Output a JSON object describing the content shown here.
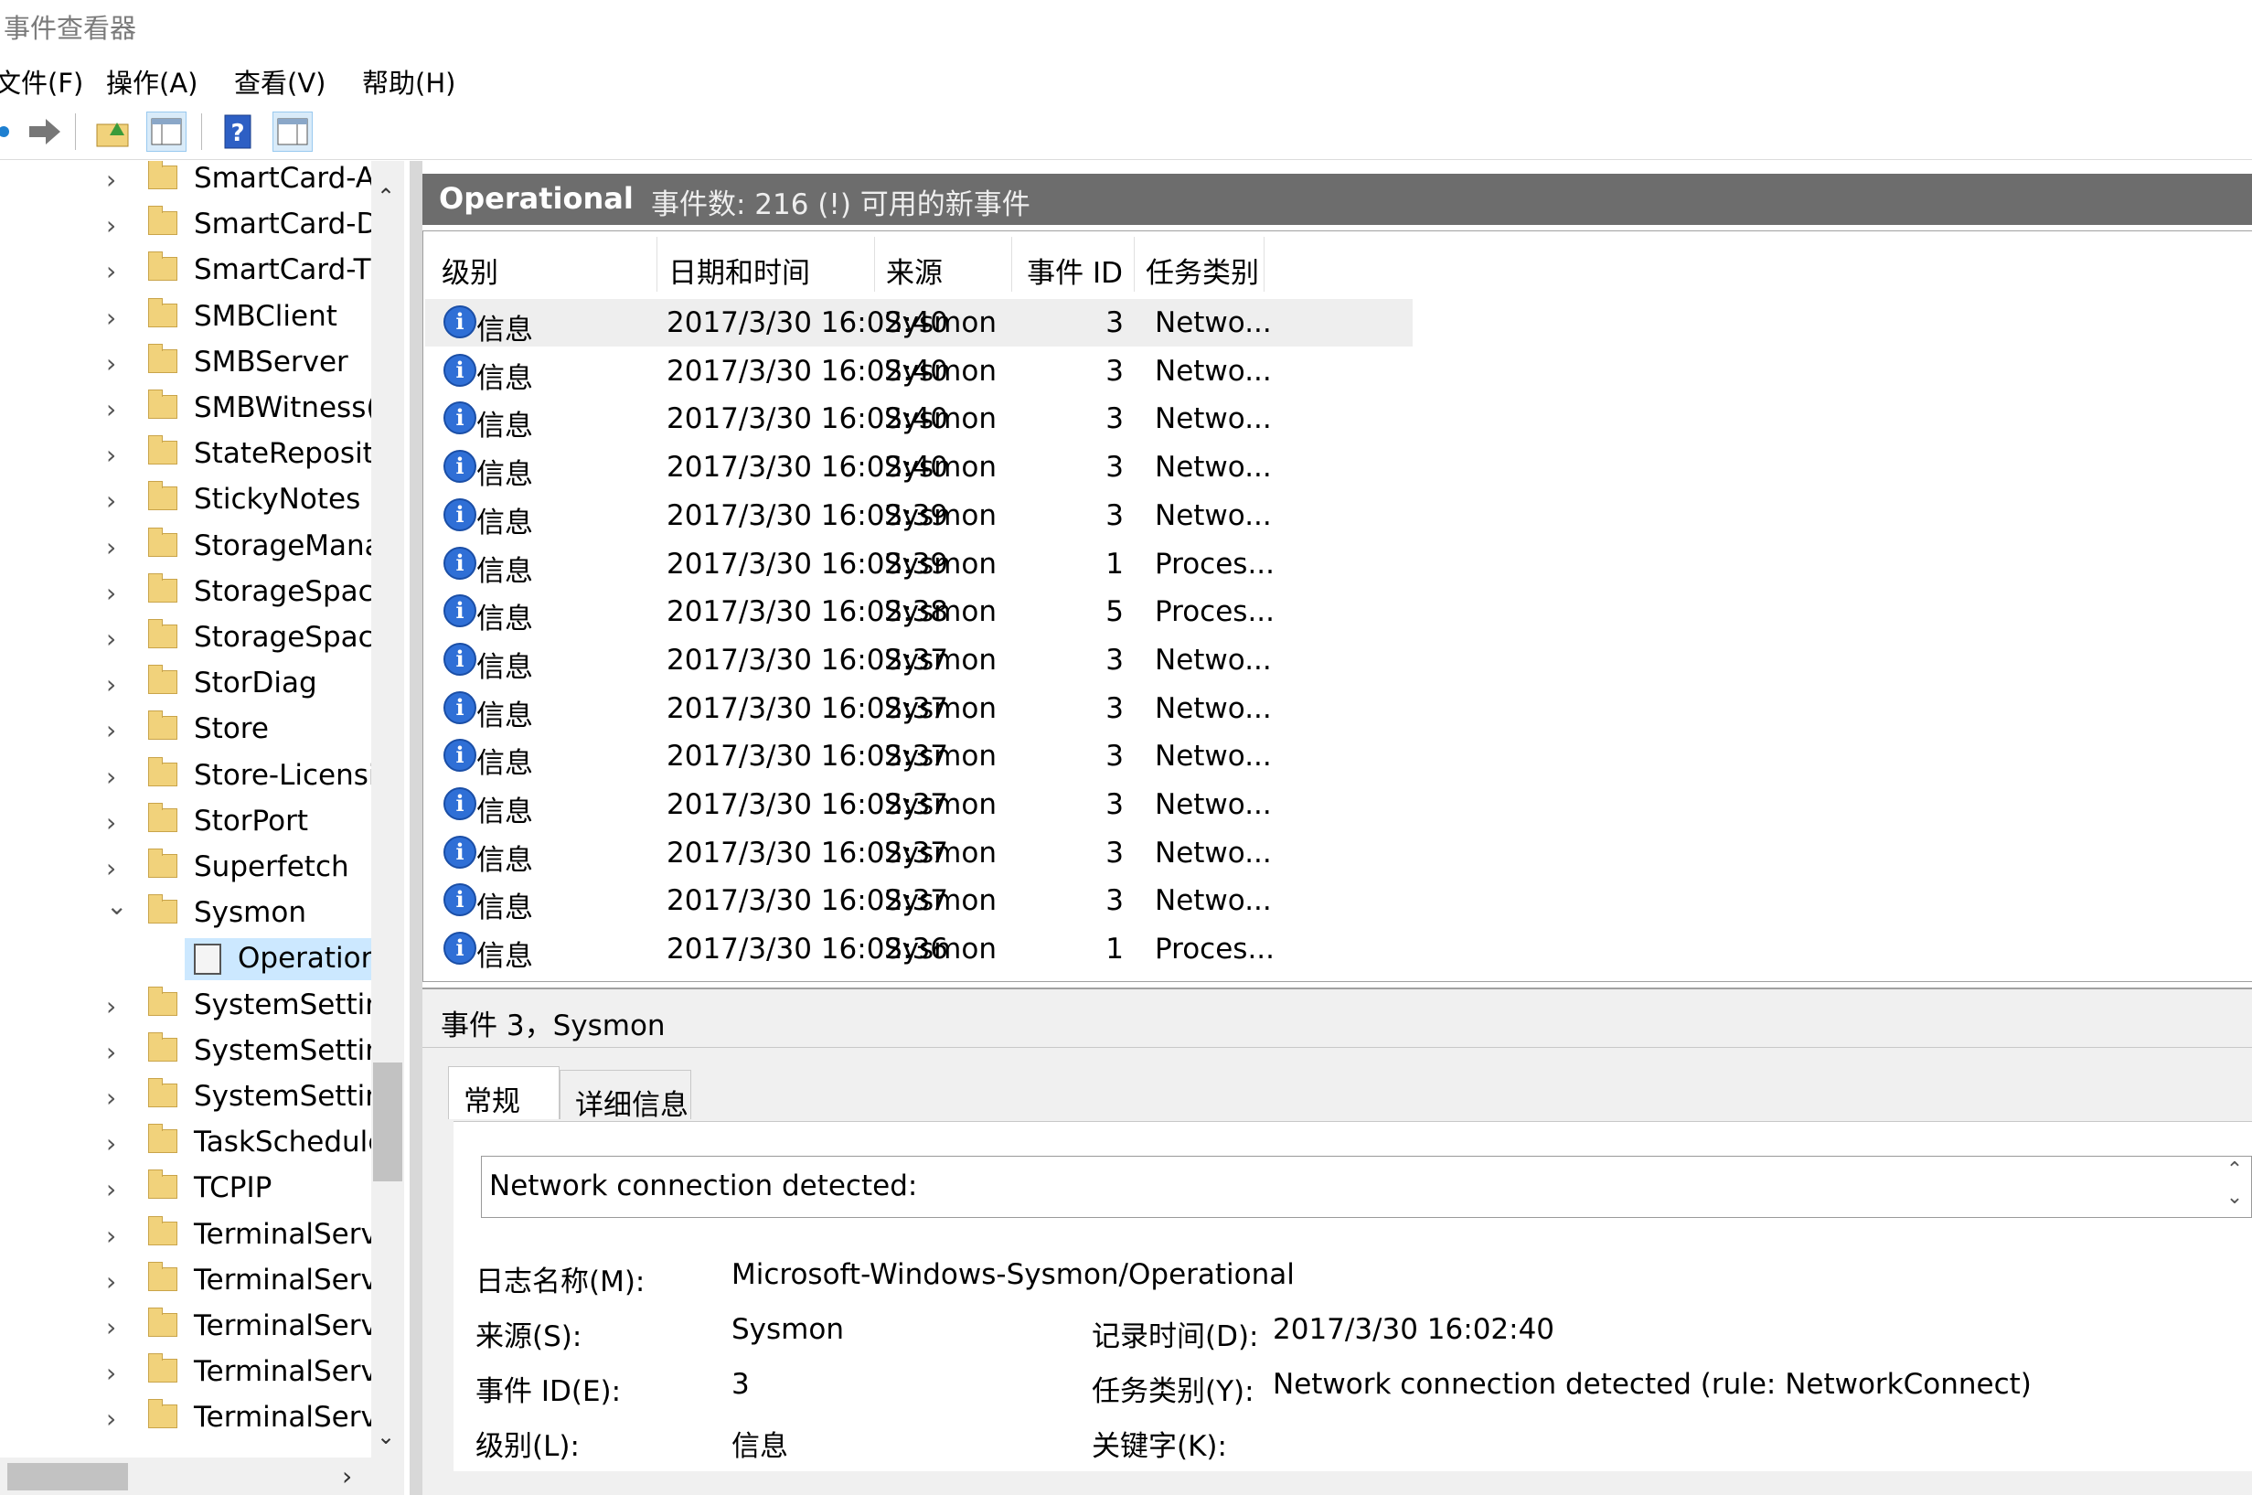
{
  "window": {
    "title": "事件查看器"
  },
  "menu": [
    {
      "label": "文件(F)"
    },
    {
      "label": "操作(A)"
    },
    {
      "label": "查看(V)"
    },
    {
      "label": "帮助(H)"
    }
  ],
  "toolbar": {
    "buttons": [
      {
        "icon": "back-icon"
      },
      {
        "icon": "forward-icon"
      },
      {
        "icon": "up-folder-icon"
      },
      {
        "icon": "show-hide-tree-icon"
      },
      {
        "icon": "help-icon"
      },
      {
        "icon": "show-hide-action-pane-icon"
      }
    ]
  },
  "tree": {
    "items": [
      {
        "label": "SmartCard-A",
        "expanded": false
      },
      {
        "label": "SmartCard-D",
        "expanded": false
      },
      {
        "label": "SmartCard-TI",
        "expanded": false
      },
      {
        "label": "SMBClient",
        "expanded": false
      },
      {
        "label": "SMBServer",
        "expanded": false
      },
      {
        "label": "SMBWitness(",
        "expanded": false
      },
      {
        "label": "StateReposito",
        "expanded": false
      },
      {
        "label": "StickyNotes",
        "expanded": false
      },
      {
        "label": "StorageMana",
        "expanded": false
      },
      {
        "label": "StorageSpac",
        "expanded": false
      },
      {
        "label": "StorageSpac",
        "expanded": false
      },
      {
        "label": "StorDiag",
        "expanded": false
      },
      {
        "label": "Store",
        "expanded": false
      },
      {
        "label": "Store-Licensi",
        "expanded": false
      },
      {
        "label": "StorPort",
        "expanded": false
      },
      {
        "label": "Superfetch",
        "expanded": false
      },
      {
        "label": "Sysmon",
        "expanded": true
      },
      {
        "label": "Operation",
        "child": true,
        "selected": true
      },
      {
        "label": "SystemSetting",
        "expanded": false
      },
      {
        "label": "SystemSetting",
        "expanded": false
      },
      {
        "label": "SystemSetting",
        "expanded": false
      },
      {
        "label": "TaskSchedule",
        "expanded": false
      },
      {
        "label": "TCPIP",
        "expanded": false
      },
      {
        "label": "TerminalServ",
        "expanded": false
      },
      {
        "label": "TerminalServ",
        "expanded": false
      },
      {
        "label": "TerminalServ",
        "expanded": false
      },
      {
        "label": "TerminalServ",
        "expanded": false
      },
      {
        "label": "TerminalServ",
        "expanded": false
      }
    ]
  },
  "log_header": {
    "name": "Operational",
    "count_text": "事件数: 216 (!) 可用的新事件"
  },
  "table": {
    "columns": [
      "级别",
      "日期和时间",
      "来源",
      "事件 ID",
      "任务类别"
    ],
    "rows": [
      {
        "level": "信息",
        "datetime": "2017/3/30 16:02:40",
        "source": "Sysmon",
        "id": "3",
        "task": "Netwo..."
      },
      {
        "level": "信息",
        "datetime": "2017/3/30 16:02:40",
        "source": "Sysmon",
        "id": "3",
        "task": "Netwo..."
      },
      {
        "level": "信息",
        "datetime": "2017/3/30 16:02:40",
        "source": "Sysmon",
        "id": "3",
        "task": "Netwo..."
      },
      {
        "level": "信息",
        "datetime": "2017/3/30 16:02:40",
        "source": "Sysmon",
        "id": "3",
        "task": "Netwo..."
      },
      {
        "level": "信息",
        "datetime": "2017/3/30 16:02:39",
        "source": "Sysmon",
        "id": "3",
        "task": "Netwo..."
      },
      {
        "level": "信息",
        "datetime": "2017/3/30 16:02:39",
        "source": "Sysmon",
        "id": "1",
        "task": "Proces..."
      },
      {
        "level": "信息",
        "datetime": "2017/3/30 16:02:38",
        "source": "Sysmon",
        "id": "5",
        "task": "Proces..."
      },
      {
        "level": "信息",
        "datetime": "2017/3/30 16:02:37",
        "source": "Sysmon",
        "id": "3",
        "task": "Netwo..."
      },
      {
        "level": "信息",
        "datetime": "2017/3/30 16:02:37",
        "source": "Sysmon",
        "id": "3",
        "task": "Netwo..."
      },
      {
        "level": "信息",
        "datetime": "2017/3/30 16:02:37",
        "source": "Sysmon",
        "id": "3",
        "task": "Netwo..."
      },
      {
        "level": "信息",
        "datetime": "2017/3/30 16:02:37",
        "source": "Sysmon",
        "id": "3",
        "task": "Netwo..."
      },
      {
        "level": "信息",
        "datetime": "2017/3/30 16:02:37",
        "source": "Sysmon",
        "id": "3",
        "task": "Netwo..."
      },
      {
        "level": "信息",
        "datetime": "2017/3/30 16:02:37",
        "source": "Sysmon",
        "id": "3",
        "task": "Netwo..."
      },
      {
        "level": "信息",
        "datetime": "2017/3/30 16:02:36",
        "source": "Sysmon",
        "id": "1",
        "task": "Proces..."
      }
    ]
  },
  "detail": {
    "title": "事件 3，Sysmon",
    "tabs": [
      "常规",
      "详细信息"
    ],
    "description": "Network connection detected:",
    "fields": {
      "log_name_label": "日志名称(M):",
      "log_name_value": "Microsoft-Windows-Sysmon/Operational",
      "source_label": "来源(S):",
      "source_value": "Sysmon",
      "logged_label": "记录时间(D):",
      "logged_value": "2017/3/30 16:02:40",
      "event_id_label": "事件 ID(E):",
      "event_id_value": "3",
      "task_label": "任务类别(Y):",
      "task_value": "Network connection detected (rule: NetworkConnect)",
      "level_label": "级别(L):",
      "level_value": "信息",
      "keywords_label": "关键字(K):"
    }
  },
  "colors": {
    "header_bg": "#6d6d6d",
    "selection": "#cce8ff",
    "info_icon": "#2f6fd6"
  }
}
